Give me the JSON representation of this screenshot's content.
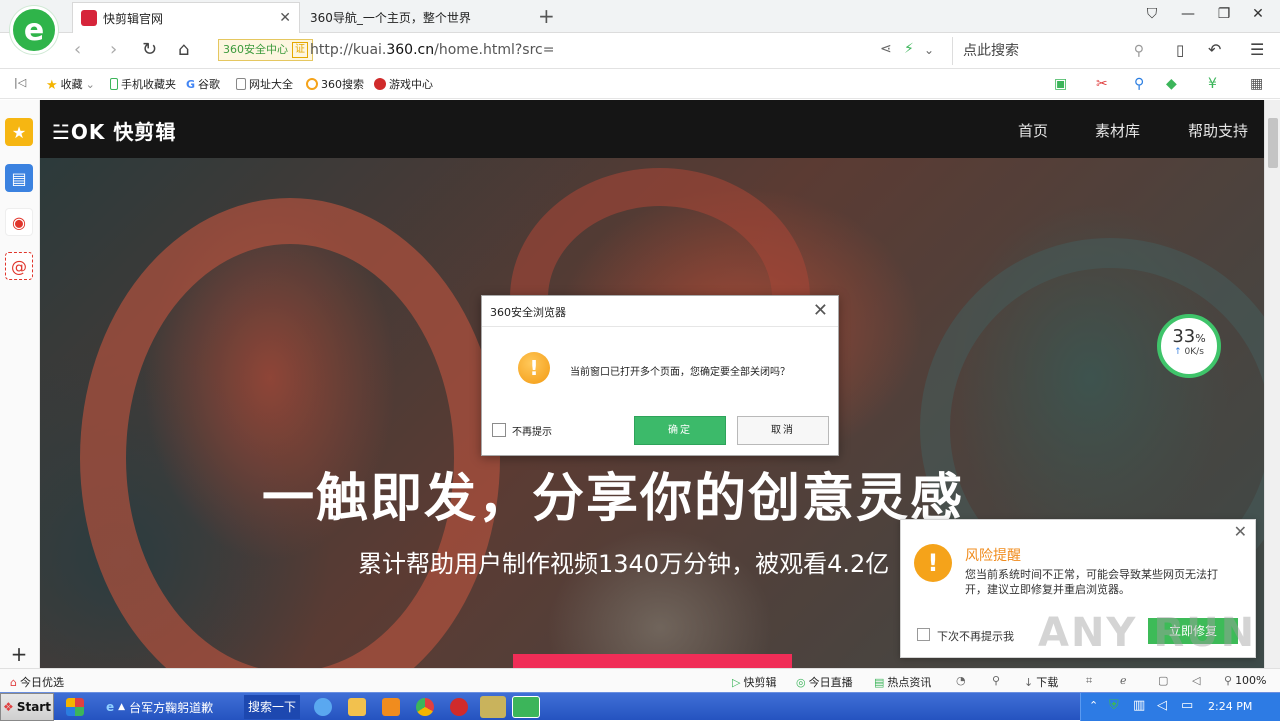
{
  "browser": {
    "tabs": [
      {
        "label": "快剪辑官网",
        "active": true
      },
      {
        "label": "360导航_一个主页，整个世界",
        "active": false
      }
    ],
    "security_badge": "360安全中心",
    "security_zheng": "证",
    "url_prefix": "http://kuai.",
    "url_domain": "360.cn",
    "url_suffix": "/home.html?src=",
    "search_placeholder": "点此搜索"
  },
  "bookmarks": [
    {
      "label": "收藏",
      "icon": "star-icon"
    },
    {
      "label": "手机收藏夹",
      "icon": "phone-icon"
    },
    {
      "label": "谷歌",
      "icon": "google-icon"
    },
    {
      "label": "网址大全",
      "icon": "page-icon"
    },
    {
      "label": "360搜索",
      "icon": "search-360-icon"
    },
    {
      "label": "游戏中心",
      "icon": "game-icon"
    }
  ],
  "site": {
    "brand": "☱OK 快剪辑",
    "nav": [
      "首页",
      "素材库",
      "帮助支持"
    ],
    "headline": "一触即发，分享你的创意灵感",
    "subline": "累计帮助用户制作视频1340万分钟，被观看4.2亿"
  },
  "speed_widget": {
    "percent": "33",
    "unit": "%",
    "rate": "0K/s"
  },
  "dialog": {
    "title": "360安全浏览器",
    "message": "当前窗口已打开多个页面，您确定要全部关闭吗？",
    "checkbox_label": "不再提示",
    "ok_label": "确定",
    "cancel_label": "取消"
  },
  "risk_popup": {
    "title": "风险提醒",
    "text": "您当前系统时间不正常，可能会导致某些网页无法打开，建议立即修复并重启浏览器。",
    "checkbox_label": "下次不再提示我",
    "button_label": "立即修复"
  },
  "statusbar": {
    "left_label": "今日优选",
    "items": [
      "快剪辑",
      "今日直播",
      "热点资讯",
      "下载"
    ],
    "zoom": "100%"
  },
  "taskbar": {
    "start": "Start",
    "task_label": "台军方鞠躬道歉",
    "search_now": "搜索一下",
    "clock": "2:24 PM"
  },
  "watermark": "ANY RUN"
}
